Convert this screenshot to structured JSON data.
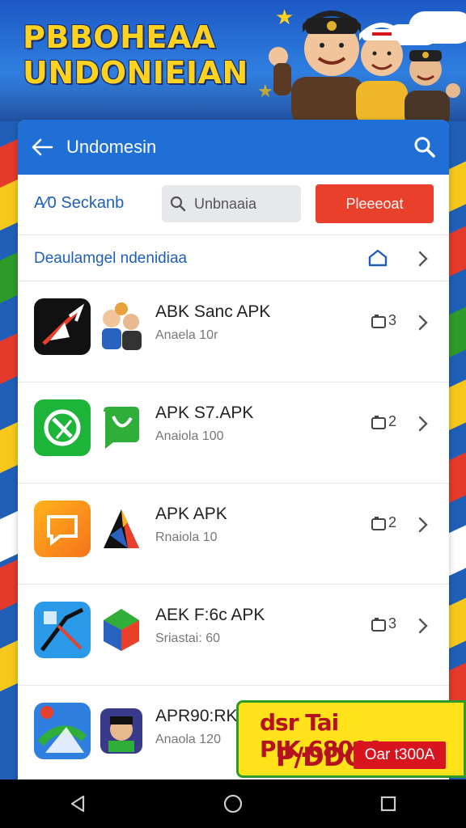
{
  "banner": {
    "title_line1": "PBBOHEAA",
    "title_line2": "UNDONIEIAN"
  },
  "appbar": {
    "title": "Undomesin"
  },
  "toolbar": {
    "label": "A⁄0 Seckanb",
    "search_placeholder": "Unbnaaia",
    "primary_button": "Pleeeoat"
  },
  "section": {
    "title": "Deaulamgel ndenidiaa"
  },
  "apps": [
    {
      "name": "ABK Sanc APK",
      "subtitle": "Anaela 10r",
      "count": "3",
      "icon1": "arrow-app-icon",
      "icon2": "people-app-icon"
    },
    {
      "name": "APK S7.APK",
      "subtitle": "Anaiola 100",
      "count": "2",
      "icon1": "gear-app-icon",
      "icon2": "chat-app-icon"
    },
    {
      "name": "APK APK",
      "subtitle": "Rnaiola 10",
      "count": "2",
      "icon1": "photo-app-icon",
      "icon2": "prism-app-icon"
    },
    {
      "name": "AEK F:6c APK",
      "subtitle": "Sriastai: 60",
      "count": "3",
      "icon1": "map-app-icon",
      "icon2": "cube-app-icon"
    },
    {
      "name": "APR90:RK",
      "subtitle": "Anaola 120",
      "count": "",
      "icon1": "maps-app-icon",
      "icon2": "avatar-app-icon"
    }
  ],
  "promo": {
    "line1": "dsr Tai PIK.68000",
    "line2": "P/DDO",
    "tag": "Oar t300A"
  },
  "colors": {
    "accent": "#1f6fd6",
    "button": "#e8402a",
    "promo_bg": "#ffe21a",
    "promo_text": "#b3121e"
  }
}
